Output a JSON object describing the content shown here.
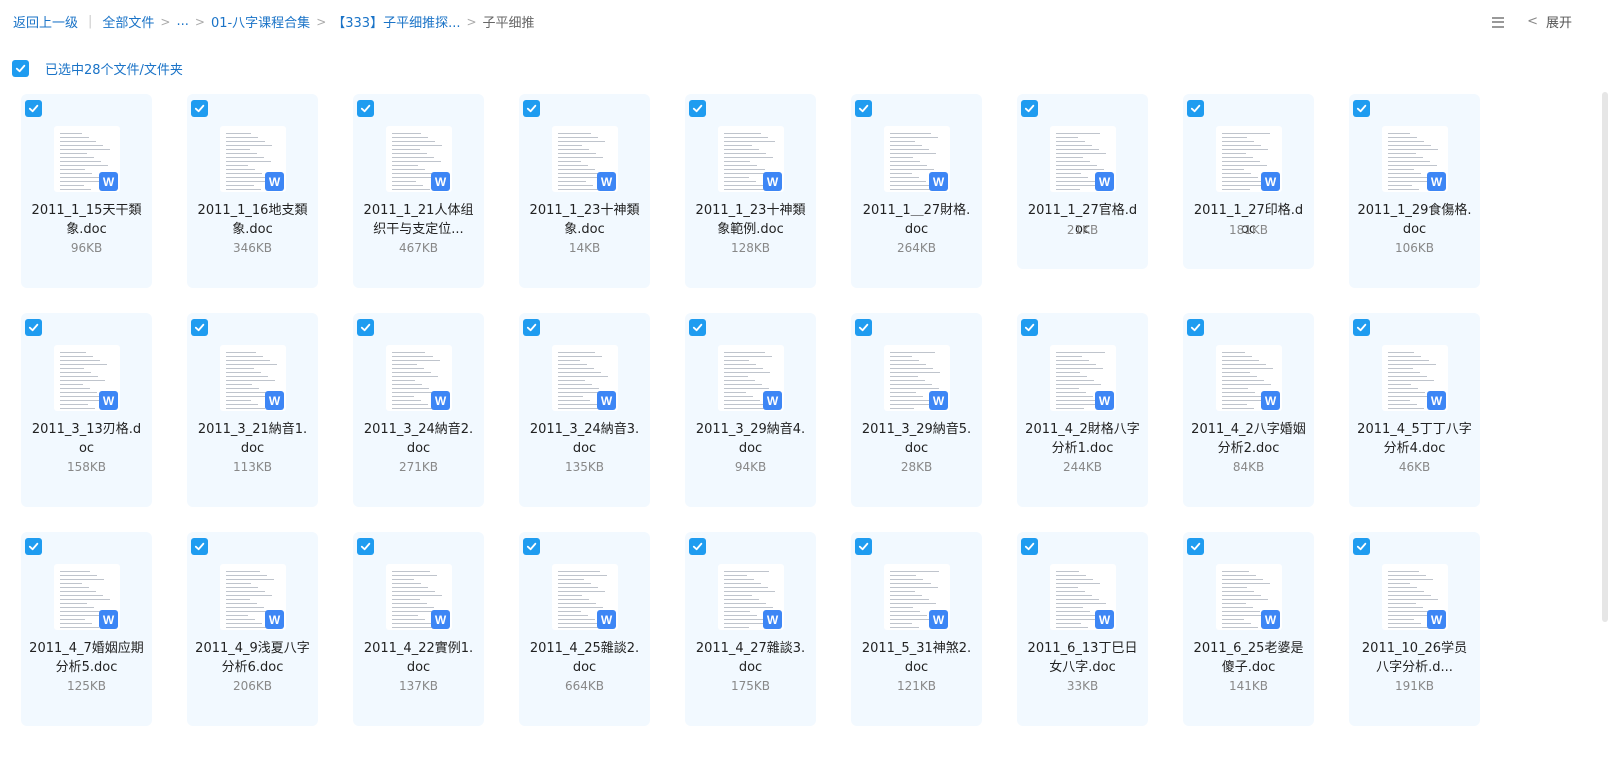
{
  "breadcrumb": {
    "back": "返回上一级",
    "all_files": "全部文件",
    "ellipsis": "...",
    "level1": "01-八字课程合集",
    "level2": "【333】子平细推探...",
    "current": "子平细推"
  },
  "toolbar": {
    "expand_label": "展开",
    "list_icon": "list-view-icon",
    "chevron_icon": "chevron-left-icon"
  },
  "selection": {
    "label": "已选中28个文件/文件夹",
    "checked": true
  },
  "colors": {
    "accent": "#1f9cf0",
    "link": "#1a73c7",
    "tile_bg": "#f2f9ff",
    "word_badge": "#3d86f5"
  },
  "files": [
    {
      "name": "2011_1_15天干類象.doc",
      "size": "96KB"
    },
    {
      "name": "2011_1_16地支類象.doc",
      "size": "346KB"
    },
    {
      "name": "2011_1_21人体组织干与支定位...",
      "size": "467KB"
    },
    {
      "name": "2011_1_23十神類象.doc",
      "size": "14KB"
    },
    {
      "name": "2011_1_23十神類象範例.doc",
      "size": "128KB"
    },
    {
      "name": "2011_1＿27財格.doc",
      "size": "264KB"
    },
    {
      "name": "2011_1_27官格.doc",
      "size": "21KB"
    },
    {
      "name": "2011_1_27印格.doc",
      "size": "181KB"
    },
    {
      "name": "2011_1_29食傷格.doc",
      "size": "106KB"
    },
    {
      "name": "2011_3_13刃格.doc",
      "size": "158KB"
    },
    {
      "name": "2011_3_21納音1.doc",
      "size": "113KB"
    },
    {
      "name": "2011_3_24納音2.doc",
      "size": "271KB"
    },
    {
      "name": "2011_3_24納音3.doc",
      "size": "135KB"
    },
    {
      "name": "2011_3_29納音4.doc",
      "size": "94KB"
    },
    {
      "name": "2011_3_29納音5.doc",
      "size": "28KB"
    },
    {
      "name": "2011_4_2財格八字分析1.doc",
      "size": "244KB"
    },
    {
      "name": "2011_4_2八字婚姻分析2.doc",
      "size": "84KB"
    },
    {
      "name": "2011_4_5丁丁八字分析4.doc",
      "size": "46KB"
    },
    {
      "name": "2011_4_7婚姻应期分析5.doc",
      "size": "125KB"
    },
    {
      "name": "2011_4_9浅夏八字分析6.doc",
      "size": "206KB"
    },
    {
      "name": "2011_4_22實例1.doc",
      "size": "137KB"
    },
    {
      "name": "2011_4_25雜談2.doc",
      "size": "664KB"
    },
    {
      "name": "2011_4_27雜談3.doc",
      "size": "175KB"
    },
    {
      "name": "2011_5_31神煞2.doc",
      "size": "121KB"
    },
    {
      "name": "2011_6_13丁巳日女八字.doc",
      "size": "33KB"
    },
    {
      "name": "2011_6_25老婆是傻子.doc",
      "size": "141KB"
    },
    {
      "name": "2011_10_26学员八字分析.d...",
      "size": "191KB"
    }
  ]
}
